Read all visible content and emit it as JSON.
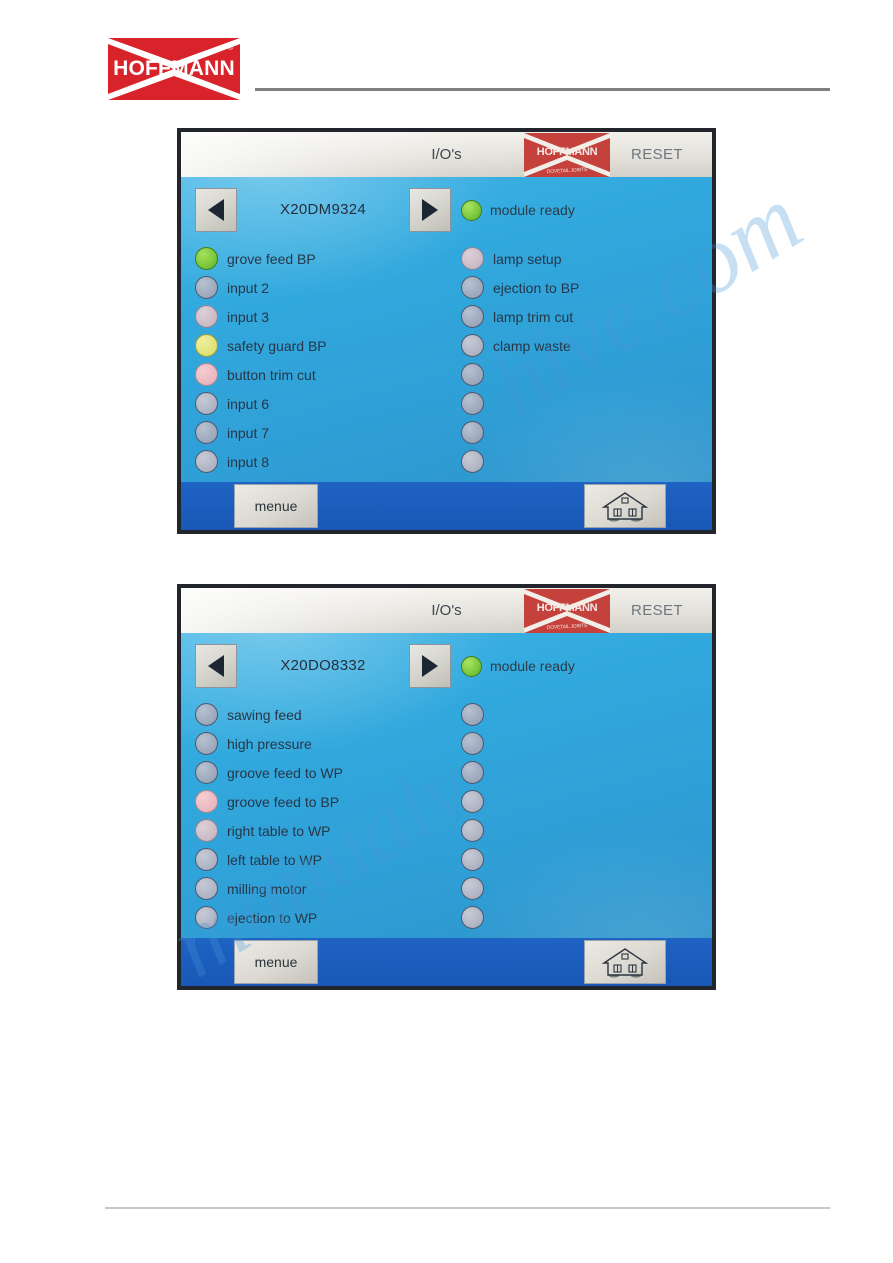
{
  "document": {
    "brand": {
      "name": "HOFFMANN",
      "registered_mark": "®",
      "color": "#d8232a"
    }
  },
  "watermark": {
    "line_1": "hive.com",
    "line_2": "manualv"
  },
  "screens": [
    {
      "id": "screen-1",
      "titlebar": {
        "title": "I/O's",
        "logo_word": "HOFFMANN",
        "logo_sub": "DOVETAIL JOINTS",
        "reset_label": "RESET"
      },
      "nav": {
        "prev_icon": "triangle-left-icon",
        "next_icon": "triangle-right-icon",
        "module_name": "X20DM9324",
        "status_label": "module ready",
        "status_color": "#5cb327"
      },
      "inputs_left": [
        {
          "label": "grove feed BP",
          "state": "green"
        },
        {
          "label": "input 2",
          "state": "off"
        },
        {
          "label": "input 3",
          "state": "rose"
        },
        {
          "label": "safety guard BP",
          "state": "yellow"
        },
        {
          "label": "button trim cut",
          "state": "pink"
        },
        {
          "label": "input 6",
          "state": "off2"
        },
        {
          "label": "input 7",
          "state": "off"
        },
        {
          "label": "input 8",
          "state": "off2"
        }
      ],
      "inputs_right": [
        {
          "label": "lamp setup",
          "state": "rose"
        },
        {
          "label": "ejection to BP",
          "state": "off"
        },
        {
          "label": "lamp trim cut",
          "state": "off"
        },
        {
          "label": "clamp waste",
          "state": "off2"
        },
        {
          "label": "",
          "state": "off"
        },
        {
          "label": "",
          "state": "off"
        },
        {
          "label": "",
          "state": "off"
        },
        {
          "label": "",
          "state": "off2"
        }
      ],
      "toolbar": {
        "menu_label": "menue",
        "home_icon": "home-icon"
      }
    },
    {
      "id": "screen-2",
      "titlebar": {
        "title": "I/O's",
        "logo_word": "HOFFMANN",
        "logo_sub": "DOVETAIL JOINTS",
        "reset_label": "RESET"
      },
      "nav": {
        "prev_icon": "triangle-left-icon",
        "next_icon": "triangle-right-icon",
        "module_name": "X20DO8332",
        "status_label": "module ready",
        "status_color": "#5cb327"
      },
      "inputs_left": [
        {
          "label": "sawing feed",
          "state": "off"
        },
        {
          "label": "high pressure",
          "state": "off"
        },
        {
          "label": "groove feed to WP",
          "state": "off"
        },
        {
          "label": "groove feed to BP",
          "state": "pink"
        },
        {
          "label": "right table to WP",
          "state": "rose"
        },
        {
          "label": "left table to WP",
          "state": "off2"
        },
        {
          "label": "milling motor",
          "state": "off2"
        },
        {
          "label": "ejection to WP",
          "state": "off2"
        }
      ],
      "inputs_right": [
        {
          "label": "",
          "state": "off"
        },
        {
          "label": "",
          "state": "off"
        },
        {
          "label": "",
          "state": "off"
        },
        {
          "label": "",
          "state": "off2"
        },
        {
          "label": "",
          "state": "off2"
        },
        {
          "label": "",
          "state": "off2"
        },
        {
          "label": "",
          "state": "off2"
        },
        {
          "label": "",
          "state": "off2"
        }
      ],
      "toolbar": {
        "menu_label": "menue",
        "home_icon": "home-icon"
      }
    }
  ]
}
